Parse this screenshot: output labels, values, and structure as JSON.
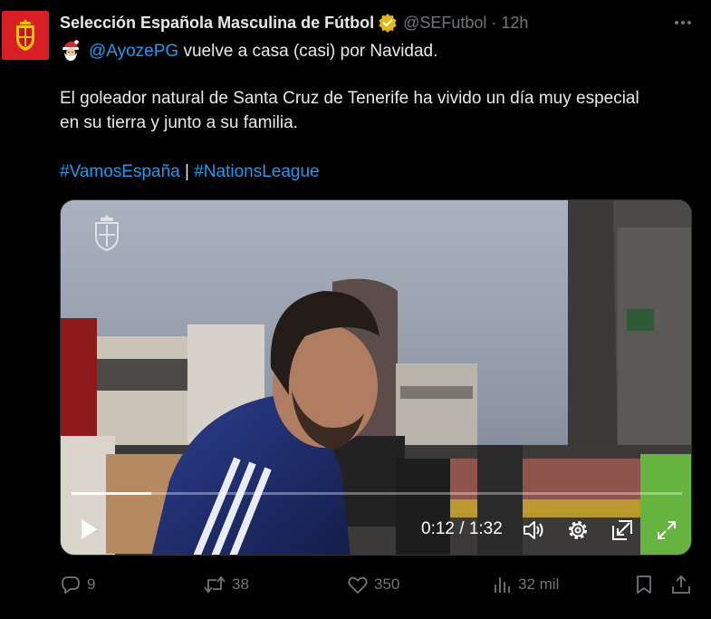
{
  "author": {
    "name": "Selección Española Masculina de Fútbol",
    "handle": "@SEFutbol",
    "separator": "·",
    "time": "12h",
    "avatar_icon": "spain-crest-icon",
    "verified_color": "#e2b719"
  },
  "tweet": {
    "mention": "@AyozePG",
    "line1_rest": " vuelve a casa (casi) por Navidad.",
    "line2": "El goleador natural de Santa Cruz de Tenerife ha vivido un día muy especial",
    "line3": "en su tierra y junto a su familia.",
    "hashtag1": "#VamosEspaña",
    "hashtag_separator": " | ",
    "hashtag2": "#NationsLeague",
    "emoji_icon": "santa-emoji-icon",
    "link_color": "#1d9bf0"
  },
  "video": {
    "current_time": "0:12",
    "time_separator": " / ",
    "duration": "1:32",
    "progress": 0.13,
    "controls": [
      "play-icon",
      "volume-icon",
      "settings-icon",
      "popout-icon",
      "fullscreen-icon"
    ]
  },
  "actions": {
    "replies": "9",
    "reposts": "38",
    "likes": "350",
    "views": "32 mil"
  }
}
